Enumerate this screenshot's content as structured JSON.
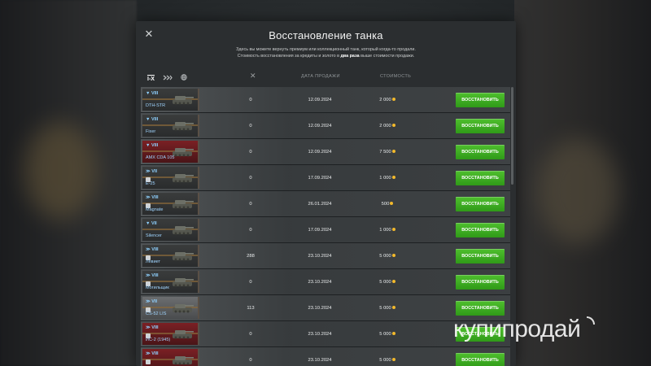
{
  "modal": {
    "title": "Восстановление танка",
    "desc_line1": "Здесь вы можете вернуть премиум или коллекционный танк, который когда-то продали.",
    "desc_line2a": "Стоимость восстановления за кредиты и золото в ",
    "desc_bold": "два раза",
    "desc_line2b": " выше стоимости продажи."
  },
  "filters": {
    "tier_label": "I-X",
    "nation_icon": "chevrons-icon",
    "globe_icon": "globe-icon"
  },
  "columns": {
    "x_icon": "✕",
    "date": "ДАТА ПРОДАЖИ",
    "cost": "СТОИМОСТЬ"
  },
  "button_label": "ВОССТАНОВИТЬ",
  "rows": [
    {
      "tier": "▼ VIII",
      "name": "DTH-STR",
      "x": "0",
      "date": "12.09.2024",
      "cost": "2 000",
      "theme": "dark"
    },
    {
      "tier": "▼ VIII",
      "name": "Fixer",
      "x": "0",
      "date": "12.09.2024",
      "cost": "2 000",
      "theme": "dark"
    },
    {
      "tier": "▼ VIII",
      "name": "AMX CDA 105",
      "x": "0",
      "date": "12.09.2024",
      "cost": "7 500",
      "theme": "red"
    },
    {
      "tier": "≫ VII",
      "name": "E-25",
      "x": "0",
      "date": "17.09.2024",
      "cost": "1 000",
      "theme": "dark"
    },
    {
      "tier": "≫ VIII",
      "name": "Magnate",
      "x": "0",
      "date": "26.01.2024",
      "cost": "500",
      "theme": "dark"
    },
    {
      "tier": "▼ VII",
      "name": "Silencer",
      "x": "0",
      "date": "17.09.2024",
      "cost": "1 000",
      "theme": "dark"
    },
    {
      "tier": "≫ VIII",
      "name": "Левиет",
      "x": "288",
      "date": "23.10.2024",
      "cost": "5 000",
      "theme": "dark"
    },
    {
      "tier": "≫ VIII",
      "name": "Mогильщик",
      "x": "0",
      "date": "23.10.2024",
      "cost": "5 000",
      "theme": "dark"
    },
    {
      "tier": "≫ VII",
      "name": "CS-52 LIS",
      "x": "113",
      "date": "23.10.2024",
      "cost": "5 000",
      "theme": "grey"
    },
    {
      "tier": "≫ VIII",
      "name": "ИС-2 (1945)",
      "x": "0",
      "date": "23.10.2024",
      "cost": "5 000",
      "theme": "red"
    },
    {
      "tier": "≫ VIII",
      "name": "",
      "x": "0",
      "date": "23.10.2024",
      "cost": "5 000",
      "theme": "red"
    }
  ],
  "watermark": "купипродай"
}
